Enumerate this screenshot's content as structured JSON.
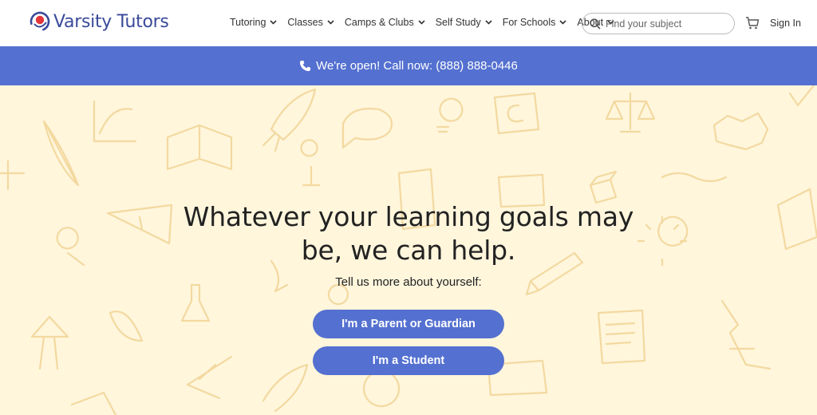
{
  "header": {
    "logo_text": "Varsity Tutors",
    "nav": [
      {
        "label": "Tutoring"
      },
      {
        "label": "Classes"
      },
      {
        "label": "Camps & Clubs"
      },
      {
        "label": "Self Study"
      },
      {
        "label": "For Schools"
      },
      {
        "label": "About"
      }
    ],
    "search_placeholder": "Find your subject",
    "signin_label": "Sign In"
  },
  "banner": {
    "text": "We're open! Call now: (888) 888-0446"
  },
  "hero": {
    "headline_line1": "Whatever your learning goals may",
    "headline_line2": "be, we can help.",
    "subheading": "Tell us more about yourself:",
    "buttons": {
      "parent": "I'm a Parent or Guardian",
      "student": "I'm a Student"
    }
  },
  "colors": {
    "accent": "#5470d0",
    "hero_bg": "#fff6dc",
    "doodle": "#f3d9a0"
  }
}
